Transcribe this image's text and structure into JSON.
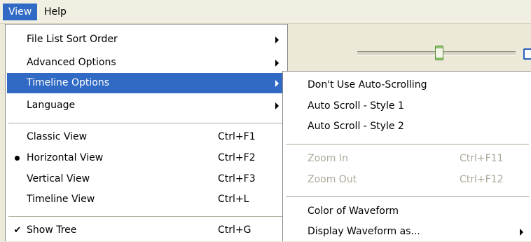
{
  "menubar": {
    "view": "View",
    "help": "Help"
  },
  "view_menu": {
    "items": [
      {
        "label": "File List Sort Order",
        "submenu": true
      },
      {
        "label": "Advanced Options",
        "submenu": true
      },
      {
        "label": "Timeline Options",
        "submenu": true,
        "highlighted": true
      },
      {
        "label": "Language",
        "submenu": true
      },
      {
        "label": "Classic View",
        "shortcut": "Ctrl+F1"
      },
      {
        "label": "Horizontal View",
        "shortcut": "Ctrl+F2",
        "selected": true
      },
      {
        "label": "Vertical View",
        "shortcut": "Ctrl+F3"
      },
      {
        "label": "Timeline View",
        "shortcut": "Ctrl+L"
      },
      {
        "label": "Show Tree",
        "shortcut": "Ctrl+G",
        "checked": true,
        "check_glyph": "✔"
      }
    ]
  },
  "timeline_submenu": {
    "items": [
      {
        "label": "Don't Use Auto-Scrolling"
      },
      {
        "label": "Auto Scroll - Style 1"
      },
      {
        "label": "Auto Scroll - Style 2"
      },
      {
        "label": "Zoom In",
        "shortcut": "Ctrl+F11",
        "disabled": true
      },
      {
        "label": "Zoom Out",
        "shortcut": "Ctrl+F12",
        "disabled": true
      },
      {
        "label": "Color of Waveform"
      },
      {
        "label": "Display Waveform as...",
        "submenu": true
      }
    ]
  },
  "toolbar": {
    "zoom_slider_level": 0.5
  },
  "colors": {
    "highlight": "#316ac5",
    "disabled_text": "#aca899",
    "menu_bg": "#ffffff",
    "chrome_bg": "#ece9d8"
  }
}
